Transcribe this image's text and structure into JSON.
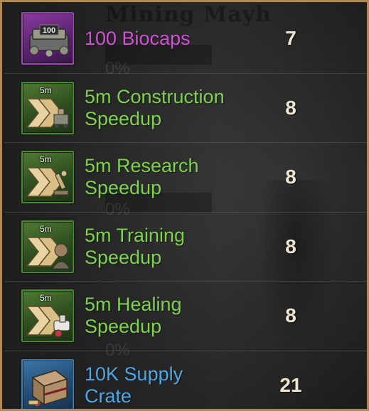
{
  "background": {
    "title": "Mining Mayh",
    "percent_labels": [
      "0%",
      "0%",
      "0%"
    ]
  },
  "rewards": [
    {
      "name": "100 Biocaps",
      "quantity": "7",
      "rarity_color": "#d24fd8",
      "icon": "biocaps-icon",
      "icon_label": "100"
    },
    {
      "name": "5m Construction Speedup",
      "quantity": "8",
      "rarity_color": "#7ed34a",
      "icon": "construction-speedup-icon",
      "icon_label": "5m"
    },
    {
      "name": "5m Research Speedup",
      "quantity": "8",
      "rarity_color": "#7ed34a",
      "icon": "research-speedup-icon",
      "icon_label": "5m"
    },
    {
      "name": "5m Training Speedup",
      "quantity": "8",
      "rarity_color": "#7ed34a",
      "icon": "training-speedup-icon",
      "icon_label": "5m"
    },
    {
      "name": "5m Healing Speedup",
      "quantity": "8",
      "rarity_color": "#7ed34a",
      "icon": "healing-speedup-icon",
      "icon_label": "5m"
    },
    {
      "name": "10K Supply Crate",
      "quantity": "21",
      "rarity_color": "#4aa8e8",
      "icon": "supply-crate-icon",
      "icon_label": ""
    }
  ]
}
